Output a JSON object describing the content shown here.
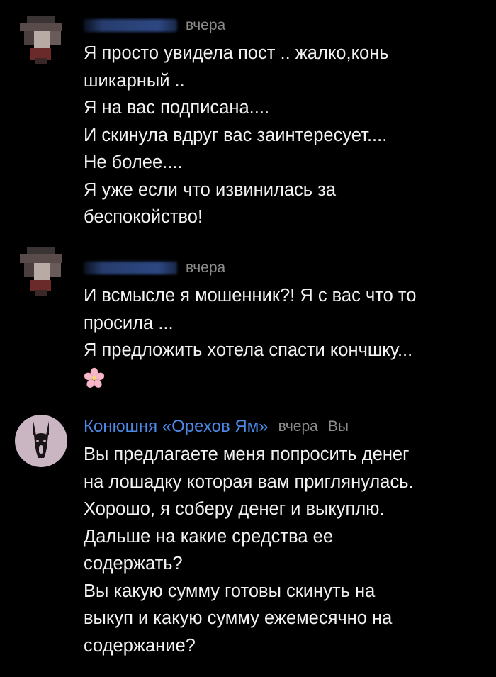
{
  "comments": [
    {
      "avatar_icon": "blurred-avatar-icon",
      "author_hidden": true,
      "time": "вчера",
      "lines": [
        "Я просто увидела пост .. жалко,конь",
        "шикарный ..",
        "Я на вас подписана....",
        "И скинула вдруг вас заинтересует....",
        "Не более....",
        "Я уже если что извинилась за",
        "беспокойство!"
      ]
    },
    {
      "avatar_icon": "blurred-avatar-icon",
      "author_hidden": true,
      "time": "вчера",
      "lines": [
        "И всмысле я мошенник?! Я с вас что то",
        "просила ...",
        "Я предложить хотела спасти кончшку..."
      ],
      "emoji_icon": "cherry-blossom-icon"
    },
    {
      "avatar_icon": "donkey-logo-icon",
      "author": "Конюшня «Орехов Ям»",
      "time": "вчера",
      "you_label": "Вы",
      "lines": [
        "Вы предлагаете меня попросить денег",
        "на лошадку которая вам приглянулась.",
        "Хорошо, я соберу денег и выкуплю.",
        "Дальше на какие средства ее",
        "содержать?",
        "Вы какую сумму готовы скинуть на",
        "выкуп и какую сумму ежемесячно на",
        "содержание?"
      ]
    }
  ],
  "colors": {
    "background": "#000000",
    "text": "#f2f2f2",
    "author_link": "#4c89e8",
    "muted": "#8c8c8c"
  }
}
